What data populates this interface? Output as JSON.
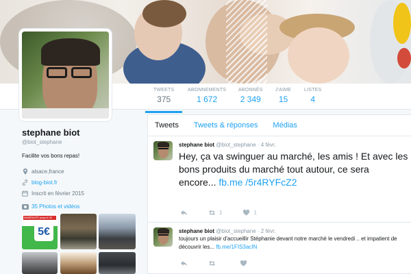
{
  "nav": {
    "stats": [
      {
        "label": "TWEETS",
        "value": "375",
        "active": true
      },
      {
        "label": "ABONNEMENTS",
        "value": "1 672"
      },
      {
        "label": "ABONNÉS",
        "value": "2 349"
      },
      {
        "label": "J'AIME",
        "value": "15"
      },
      {
        "label": "LISTES",
        "value": "4"
      }
    ]
  },
  "profile": {
    "name": "stephane biot",
    "handle": "@biot_stephane",
    "bio": "Facilite vos bons repas!",
    "location": "alsace,france",
    "website": "blog-biot.fr",
    "joined": "Inscrit en février 2015",
    "photos_label": "35 Photos et vidéos",
    "promo_text": "IMMÉDIATE jusqu'à 30",
    "promo_price": "5€"
  },
  "timeline": {
    "tabs": [
      "Tweets",
      "Tweets & réponses",
      "Médias"
    ],
    "tweets": [
      {
        "name": "stephane biot",
        "handle": "@biot_stephane",
        "date": "· 4 févr.",
        "text": "Hey, ça va swinguer au marché, les amis ! Et avec les bons produits du marché tout autour, ce sera encore... ",
        "link": "fb.me /5r4RYFcZ2",
        "retweets": "1",
        "likes": "1"
      },
      {
        "name": "stephane biot",
        "handle": "@biot_stephane",
        "date": "· 2 févr.",
        "text": "toujours un plaisir d'accueillir Stéphanie devant notre marché le vendredi .. et impatient de découvrir les... ",
        "link": "fb.me/1FIS3acIN",
        "retweets": "",
        "likes": ""
      }
    ]
  },
  "colors": {
    "accent": "#1da1f2",
    "text": "#14171a",
    "muted": "#8899a6"
  }
}
